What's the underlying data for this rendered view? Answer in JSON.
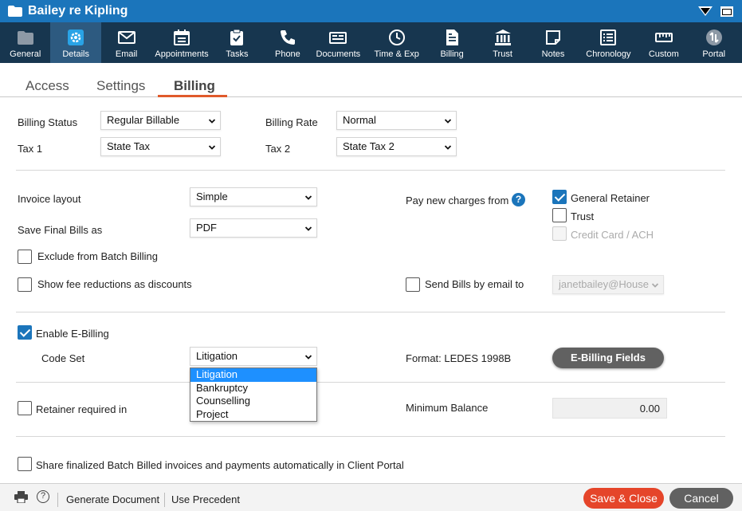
{
  "window": {
    "title": "Bailey re Kipling"
  },
  "toolbar": {
    "items": [
      {
        "label": "General",
        "icon": "folder-icon"
      },
      {
        "label": "Details",
        "icon": "gear-icon",
        "active": true
      },
      {
        "label": "Email",
        "icon": "envelope-icon"
      },
      {
        "label": "Appointments",
        "icon": "calendar-icon"
      },
      {
        "label": "Tasks",
        "icon": "clipboard-check-icon"
      },
      {
        "label": "Phone",
        "icon": "phone-icon"
      },
      {
        "label": "Documents",
        "icon": "documents-icon"
      },
      {
        "label": "Time & Exp",
        "icon": "clock-icon"
      },
      {
        "label": "Billing",
        "icon": "invoice-icon"
      },
      {
        "label": "Trust",
        "icon": "bank-icon"
      },
      {
        "label": "Notes",
        "icon": "note-icon"
      },
      {
        "label": "Chronology",
        "icon": "list-icon"
      },
      {
        "label": "Custom",
        "icon": "ruler-icon"
      },
      {
        "label": "Portal",
        "icon": "portal-icon"
      }
    ]
  },
  "tabs": [
    {
      "label": "Access"
    },
    {
      "label": "Settings"
    },
    {
      "label": "Billing",
      "active": true
    }
  ],
  "billing": {
    "billing_status_label": "Billing Status",
    "billing_status_value": "Regular Billable",
    "billing_rate_label": "Billing Rate",
    "billing_rate_value": "Normal",
    "tax1_label": "Tax 1",
    "tax1_value": "State Tax",
    "tax2_label": "Tax 2",
    "tax2_value": "State Tax 2",
    "invoice_layout_label": "Invoice layout",
    "invoice_layout_value": "Simple",
    "save_final_label": "Save Final Bills as",
    "save_final_value": "PDF",
    "pay_from_label": "Pay new charges from",
    "general_retainer_label": "General Retainer",
    "general_retainer_checked": true,
    "trust_label": "Trust",
    "trust_checked": false,
    "credit_card_label": "Credit Card / ACH",
    "credit_card_disabled": true,
    "exclude_batch_label": "Exclude from Batch Billing",
    "show_fee_label": "Show fee reductions as discounts",
    "send_email_label": "Send Bills by email to",
    "send_email_value": "janetbailey@House",
    "enable_ebilling_label": "Enable E-Billing",
    "enable_ebilling_checked": true,
    "code_set_label": "Code Set",
    "code_set_value": "Litigation",
    "code_set_options": [
      "Litigation",
      "Bankruptcy",
      "Counselling",
      "Project"
    ],
    "format_label": "Format: LEDES 1998B",
    "ebilling_fields_button": "E-Billing Fields",
    "retainer_label": "Retainer required in",
    "min_balance_label": "Minimum Balance",
    "min_balance_value": "0.00",
    "share_portal_label": "Share finalized Batch Billed invoices and payments automatically in Client Portal"
  },
  "footer": {
    "generate_document": "Generate Document",
    "use_precedent": "Use Precedent",
    "save_close": "Save & Close",
    "cancel": "Cancel"
  },
  "colors": {
    "titlebar": "#1b75bb",
    "toolbar": "#17364f",
    "toolbar_active": "#2d5a80",
    "accent_orange": "#e05a2b",
    "save_button": "#e5452a",
    "dropdown_highlight": "#1e90ff"
  }
}
